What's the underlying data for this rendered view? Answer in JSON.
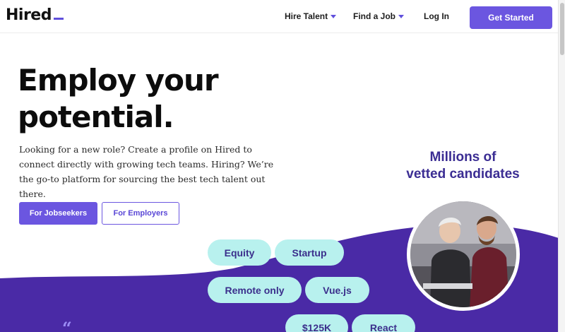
{
  "header": {
    "logo_text": "Hired",
    "nav": [
      {
        "label": "Hire Talent",
        "has_caret": true
      },
      {
        "label": "Find a Job",
        "has_caret": true
      },
      {
        "label": "Log In",
        "has_caret": false
      }
    ],
    "cta_label": "Get Started"
  },
  "hero": {
    "title_line1": "Employ your",
    "title_line2": "potential.",
    "description": "Looking for a new role? Create a profile on Hired to connect directly with growing tech teams. Hiring? We’re the go-to platform for sourcing the best tech talent out there.",
    "btn_jobseekers": "For Jobseekers",
    "btn_employers": "For Employers"
  },
  "side": {
    "line1": "Millions of",
    "line2": "vetted candidates"
  },
  "pills": [
    "Equity",
    "Startup",
    "Remote only",
    "Vue.js",
    "$125K",
    "React"
  ],
  "quote_mark": "“",
  "colors": {
    "brand_purple": "#6b56e0",
    "wave_purple": "#4a2aa6",
    "pill_teal": "#b8f1ee",
    "heading_purple": "#3b2d93"
  },
  "icons": {
    "nav_caret": "caret-down-icon",
    "quote": "quote-icon"
  }
}
